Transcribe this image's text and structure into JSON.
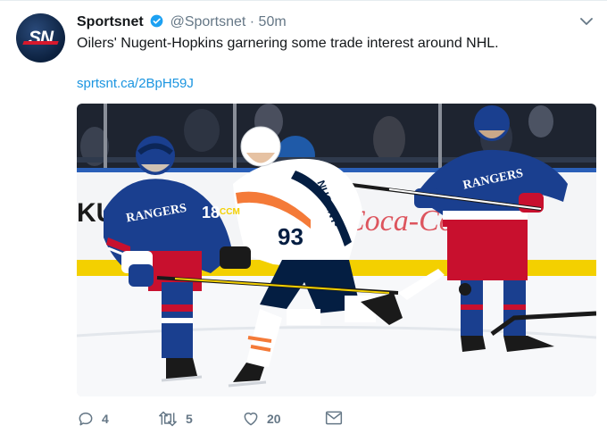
{
  "tweet": {
    "author_name": "Sportsnet",
    "author_handle": "@Sportsnet",
    "separator": "·",
    "time_ago": "50m",
    "avatar_text": "SN",
    "text": "Oilers' Nugent-Hopkins garnering some trade interest around NHL.",
    "link": "sprtsnt.ca/2BpH59J",
    "photo": {
      "jersey_left": "18",
      "jersey_center": "93",
      "name_center": "NUGENT-",
      "rangers_word": "RANGERS",
      "board_brand": "Coca-Cola",
      "stick_brand": "CCM"
    }
  },
  "actions": {
    "reply_count": "4",
    "retweet_count": "5",
    "like_count": "20"
  },
  "colors": {
    "link": "#1b95e0",
    "secondary": "#657786",
    "verified": "#1da1f2",
    "oilers_orange": "#f47a38",
    "oilers_navy": "#041e42",
    "rangers_blue": "#1a3f8f",
    "rangers_red": "#c8102e"
  }
}
